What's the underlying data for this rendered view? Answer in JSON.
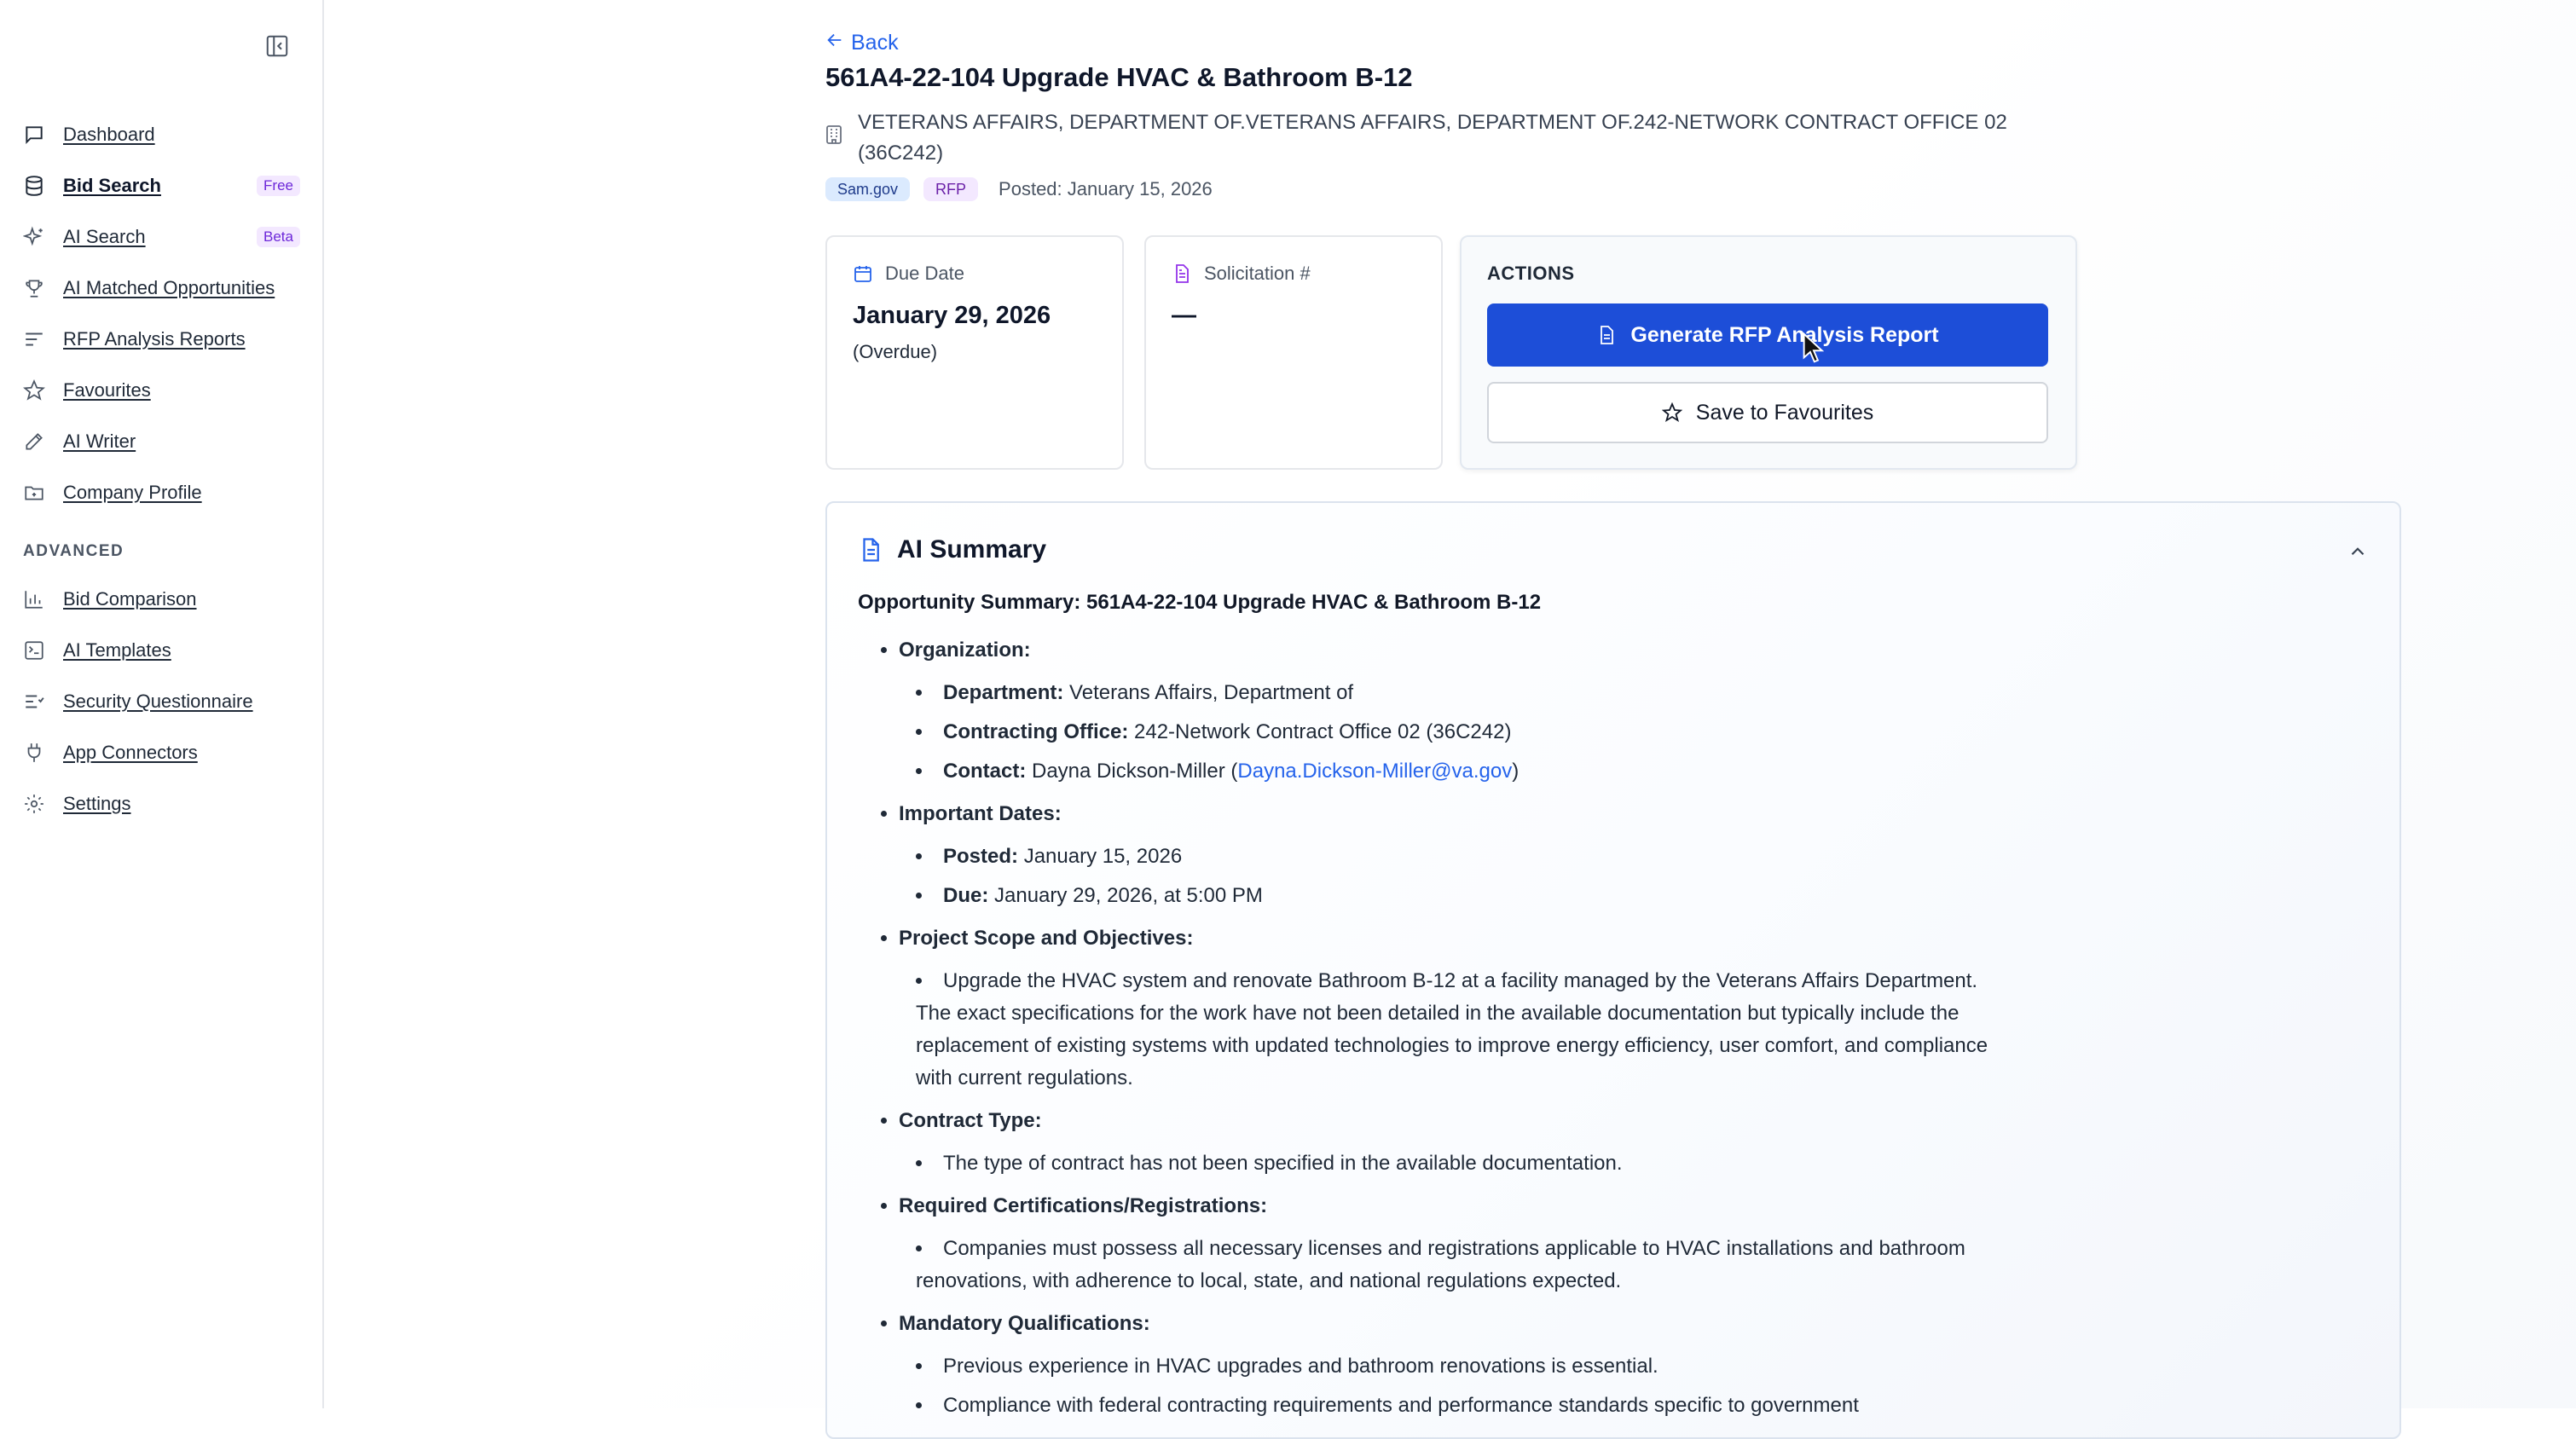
{
  "sidebar": {
    "items": [
      {
        "label": "Dashboard",
        "icon": "chat-icon",
        "badge": ""
      },
      {
        "label": "Bid Search",
        "icon": "database-icon",
        "badge": "Free"
      },
      {
        "label": "AI Search",
        "icon": "sparkles-icon",
        "badge": "Beta"
      },
      {
        "label": "AI Matched Opportunities",
        "icon": "trophy-icon",
        "badge": ""
      },
      {
        "label": "RFP Analysis Reports",
        "icon": "list-icon",
        "badge": ""
      },
      {
        "label": "Favourites",
        "icon": "star-icon",
        "badge": ""
      },
      {
        "label": "AI Writer",
        "icon": "edit-icon",
        "badge": ""
      },
      {
        "label": "Company Profile",
        "icon": "folder-icon",
        "badge": ""
      }
    ],
    "advanced_label": "ADVANCED",
    "advanced_items": [
      {
        "label": "Bid Comparison",
        "icon": "bar-chart-icon"
      },
      {
        "label": "AI Templates",
        "icon": "template-icon"
      },
      {
        "label": "Security Questionnaire",
        "icon": "list-check-icon"
      },
      {
        "label": "App Connectors",
        "icon": "plug-icon"
      },
      {
        "label": "Settings",
        "icon": "gear-icon"
      }
    ]
  },
  "header": {
    "back_label": "Back",
    "title": "561A4-22-104 Upgrade HVAC & Bathroom B-12",
    "agency": "VETERANS AFFAIRS, DEPARTMENT OF.VETERANS AFFAIRS, DEPARTMENT OF.242-NETWORK CONTRACT OFFICE 02 (36C242)",
    "source_chip": "Sam.gov",
    "type_chip": "RFP",
    "posted": "Posted: January 15, 2026"
  },
  "cards": {
    "due_label": "Due Date",
    "due_value": "January 29, 2026",
    "due_sub": "(Overdue)",
    "solicitation_label": "Solicitation #",
    "solicitation_value": "—"
  },
  "actions": {
    "title": "ACTIONS",
    "generate_label": "Generate RFP Analysis Report",
    "save_label": "Save to Favourites"
  },
  "summary": {
    "title": "AI Summary",
    "opportunity_title": "Opportunity Summary: 561A4-22-104 Upgrade HVAC & Bathroom B-12",
    "organization_heading": "Organization:",
    "department_label": "Department:",
    "department_value": "Veterans Affairs, Department of",
    "office_label": "Contracting Office:",
    "office_value": "242-Network Contract Office 02 (36C242)",
    "contact_label": "Contact:",
    "contact_name": "Dayna Dickson-Miller (",
    "contact_email": "Dayna.Dickson-Miller@va.gov",
    "contact_close": ")",
    "dates_heading": "Important Dates:",
    "posted_label": "Posted:",
    "posted_value": "January 15, 2026",
    "due_label": "Due:",
    "due_value": "January 29, 2026, at 5:00 PM",
    "scope_heading": "Project Scope and Objectives:",
    "scope_text": "Upgrade the HVAC system and renovate Bathroom B-12 at a facility managed by the Veterans Affairs Department. The exact specifications for the work have not been detailed in the available documentation but typically include the replacement of existing systems with updated technologies to improve energy efficiency, user comfort, and compliance with current regulations.",
    "contract_heading": "Contract Type:",
    "contract_text": "The type of contract has not been specified in the available documentation.",
    "certs_heading": "Required Certifications/Registrations:",
    "certs_text": "Companies must possess all necessary licenses and registrations applicable to HVAC installations and bathroom renovations, with adherence to local, state, and national regulations expected.",
    "quals_heading": "Mandatory Qualifications:",
    "quals_1": "Previous experience in HVAC upgrades and bathroom renovations is essential.",
    "quals_2": "Compliance with federal contracting requirements and performance standards specific to government"
  },
  "colors": {
    "primary": "#1d4ed8",
    "link": "#2563eb",
    "badge_purple": "#6d28d9"
  }
}
